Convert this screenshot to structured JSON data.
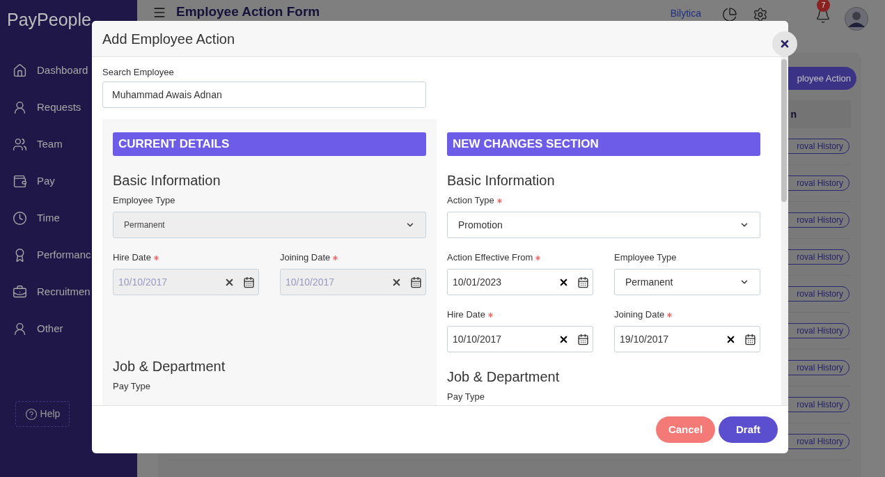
{
  "sidebar": {
    "logo": "PayPeople",
    "items": [
      {
        "label": "Dashboard"
      },
      {
        "label": "Requests"
      },
      {
        "label": "Team"
      },
      {
        "label": "Pay"
      },
      {
        "label": "Time"
      },
      {
        "label": "Performanc"
      },
      {
        "label": "Recruitmen"
      },
      {
        "label": "Other"
      }
    ],
    "help": "Help"
  },
  "topbar": {
    "title": "Employee Action Form",
    "company": "Bilytica",
    "notification_count": "7"
  },
  "page": {
    "add_button": "ployee Action",
    "table": {
      "columns": [
        "n"
      ],
      "rows": [
        {
          "action": "roval History"
        },
        {
          "action": "roval History"
        },
        {
          "action": "roval History"
        },
        {
          "action": "roval History"
        },
        {
          "action": "roval History"
        },
        {
          "action": "roval History"
        },
        {
          "action": "roval History"
        },
        {
          "action": "roval History"
        },
        {
          "action": "roval History"
        }
      ]
    }
  },
  "modal": {
    "title": "Add Employee Action",
    "search": {
      "label": "Search Employee",
      "value": "Muhammad Awais Adnan"
    },
    "sections": [
      {
        "heading": "CURRENT DETAILS",
        "disabled": true,
        "groups": [
          {
            "title": "Basic Information",
            "rows": [
              [
                {
                  "kind": "select",
                  "label": "Employee Type",
                  "required": false,
                  "value": "Permanent"
                }
              ],
              [
                {
                  "kind": "date",
                  "label": "Hire Date",
                  "required": true,
                  "value": "10/10/2017"
                },
                {
                  "kind": "date",
                  "label": "Joining Date",
                  "required": true,
                  "value": "10/10/2017"
                }
              ]
            ]
          },
          {
            "title": "Job & Department",
            "rows": [
              [
                {
                  "kind": "label",
                  "label": "Pay Type",
                  "required": false
                }
              ]
            ]
          }
        ]
      },
      {
        "heading": "NEW CHANGES SECTION",
        "disabled": false,
        "groups": [
          {
            "title": "Basic Information",
            "rows": [
              [
                {
                  "kind": "select",
                  "label": "Action Type",
                  "required": true,
                  "value": "Promotion"
                }
              ],
              [
                {
                  "kind": "date",
                  "label": "Action Effective From",
                  "required": true,
                  "value": "10/01/2023"
                },
                {
                  "kind": "select",
                  "label": "Employee Type",
                  "required": false,
                  "value": "Permanent"
                }
              ],
              [
                {
                  "kind": "date",
                  "label": "Hire Date",
                  "required": true,
                  "value": "10/10/2017"
                },
                {
                  "kind": "date",
                  "label": "Joining Date",
                  "required": true,
                  "value": "19/10/2017"
                }
              ]
            ]
          },
          {
            "title": "Job & Department",
            "rows": [
              [
                {
                  "kind": "label",
                  "label": "Pay Type",
                  "required": false
                }
              ]
            ]
          }
        ]
      }
    ],
    "buttons": [
      {
        "kind": "cancel",
        "label": "Cancel"
      },
      {
        "kind": "primary",
        "label": "Draft"
      }
    ]
  }
}
